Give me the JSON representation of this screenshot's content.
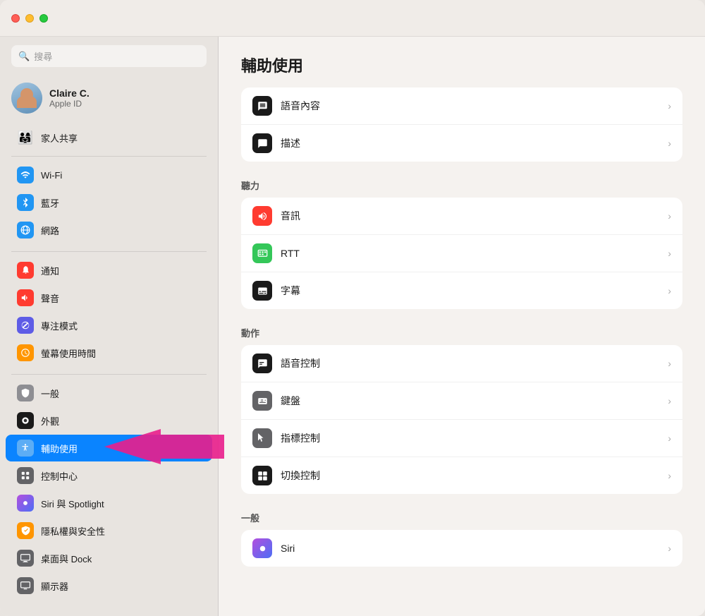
{
  "window": {
    "title": "輔助使用"
  },
  "sidebar": {
    "search_placeholder": "搜尋",
    "profile": {
      "name": "Claire C.",
      "subtitle": "Apple ID"
    },
    "family": "家人共享",
    "items": [
      {
        "id": "wifi",
        "label": "Wi-Fi",
        "icon_class": "icon-wifi",
        "icon_char": "📶"
      },
      {
        "id": "bluetooth",
        "label": "藍牙",
        "icon_class": "icon-bluetooth",
        "icon_char": "⬡"
      },
      {
        "id": "network",
        "label": "網路",
        "icon_class": "icon-network",
        "icon_char": "🌐"
      },
      {
        "id": "notifications",
        "label": "通知",
        "icon_class": "icon-notifications",
        "icon_char": "🔔"
      },
      {
        "id": "sound",
        "label": "聲音",
        "icon_class": "icon-sound",
        "icon_char": "🔊"
      },
      {
        "id": "focus",
        "label": "專注模式",
        "icon_class": "icon-focus",
        "icon_char": "🌙"
      },
      {
        "id": "screentime",
        "label": "螢幕使用時間",
        "icon_class": "icon-screentime",
        "icon_char": "⌛"
      },
      {
        "id": "general",
        "label": "一般",
        "icon_class": "icon-general",
        "icon_char": "⚙"
      },
      {
        "id": "appearance",
        "label": "外觀",
        "icon_class": "icon-appearance",
        "icon_char": "●"
      },
      {
        "id": "accessibility",
        "label": "輔助使用",
        "icon_class": "icon-accessibility",
        "icon_char": "♿",
        "active": true
      },
      {
        "id": "controlcenter",
        "label": "控制中心",
        "icon_class": "icon-controlcenter",
        "icon_char": "⊞"
      },
      {
        "id": "siri",
        "label": "Siri 與 Spotlight",
        "icon_class": "icon-siri",
        "icon_char": "◉"
      },
      {
        "id": "privacy",
        "label": "隱私權與安全性",
        "icon_class": "icon-privacy",
        "icon_char": "✋"
      },
      {
        "id": "desktop",
        "label": "桌面與 Dock",
        "icon_class": "icon-desktop",
        "icon_char": "🖥"
      },
      {
        "id": "display",
        "label": "顯示器",
        "icon_class": "icon-display",
        "icon_char": "📺"
      }
    ]
  },
  "main": {
    "page_title": "輔助使用",
    "sections": [
      {
        "id": "vision_top",
        "items": [
          {
            "id": "voice_content",
            "label": "語音內容",
            "icon_color": "#1a1a1a",
            "icon_char": "💬"
          },
          {
            "id": "describe",
            "label": "描述",
            "icon_color": "#1a1a1a",
            "icon_char": "💬"
          }
        ]
      },
      {
        "id": "hearing",
        "title": "聽力",
        "items": [
          {
            "id": "audio",
            "label": "音訊",
            "icon_color": "#ff3b30",
            "icon_char": "🔊"
          },
          {
            "id": "rtt",
            "label": "RTT",
            "icon_color": "#34c759",
            "icon_char": "⌨"
          },
          {
            "id": "captions",
            "label": "字幕",
            "icon_color": "#1a1a1a",
            "icon_char": "💬"
          }
        ]
      },
      {
        "id": "motor",
        "title": "動作",
        "items": [
          {
            "id": "voice_control",
            "label": "語音控制",
            "icon_color": "#1a1a1a",
            "icon_char": "🎤"
          },
          {
            "id": "keyboard",
            "label": "鍵盤",
            "icon_color": "#636366",
            "icon_char": "⌨"
          },
          {
            "id": "pointer",
            "label": "指標控制",
            "icon_color": "#636366",
            "icon_char": "↖"
          },
          {
            "id": "switch",
            "label": "切換控制",
            "icon_color": "#1a1a1a",
            "icon_char": "⊞"
          }
        ]
      },
      {
        "id": "general_section",
        "title": "一般",
        "items": [
          {
            "id": "siri_main",
            "label": "Siri",
            "icon_color": "gradient",
            "icon_char": "◉"
          }
        ]
      }
    ]
  },
  "colors": {
    "active_blue": "#0a84ff",
    "sidebar_bg": "#e8e4e0",
    "main_bg": "#f5f2ef",
    "card_bg": "#ffffff"
  }
}
